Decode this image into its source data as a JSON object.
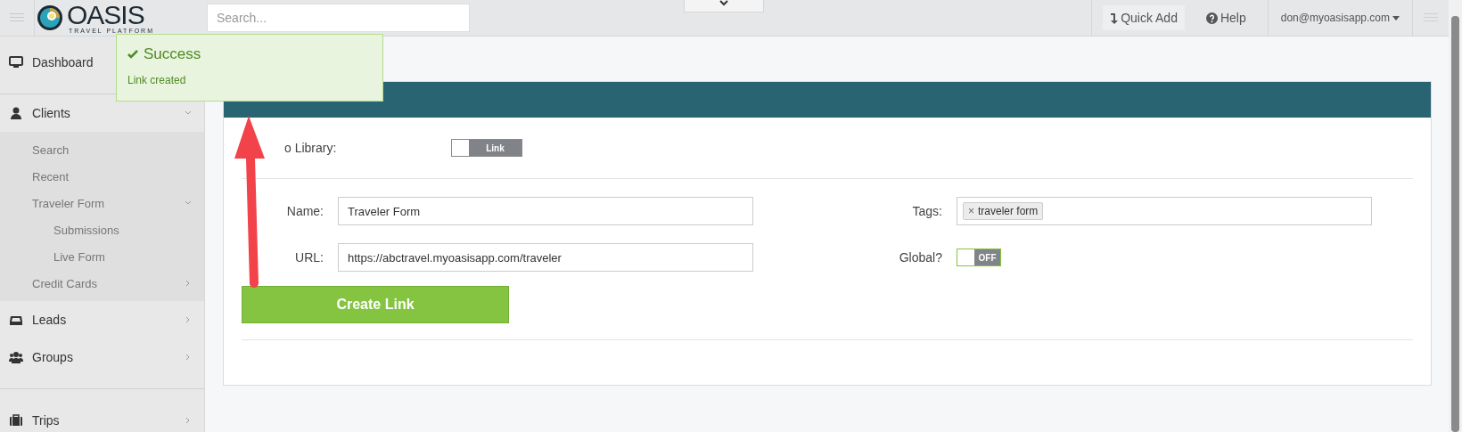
{
  "topbar": {
    "logo": {
      "name": "OASIS",
      "tagline": "TRAVEL PLATFORM"
    },
    "search": {
      "placeholder": "Search..."
    },
    "quick_add": "Quick Add",
    "help": "Help",
    "user": "don@myoasisapp.com"
  },
  "sidebar": {
    "items": [
      {
        "label": "Dashboard"
      },
      {
        "label": "Clients",
        "expanded": true,
        "children": [
          {
            "label": "Search"
          },
          {
            "label": "Recent"
          },
          {
            "label": "Traveler Form",
            "expanded": true,
            "children": [
              {
                "label": "Submissions"
              },
              {
                "label": "Live Form"
              }
            ]
          },
          {
            "label": "Credit Cards",
            "expanded": false
          }
        ]
      },
      {
        "label": "Leads",
        "expanded": false
      },
      {
        "label": "Groups",
        "expanded": false
      },
      {
        "label": "Trips",
        "expanded": false
      }
    ]
  },
  "toast": {
    "title": "Success",
    "message": "Link created"
  },
  "card": {
    "library": {
      "label": "o Library:",
      "toggle": {
        "label": "Link",
        "on": false
      }
    },
    "name": {
      "label": "Name:",
      "value": "Traveler Form"
    },
    "url": {
      "label": "URL:",
      "value": "https://abctravel.myoasisapp.com/traveler"
    },
    "tags": {
      "label": "Tags:",
      "items": [
        {
          "remove": "×",
          "text": "traveler form"
        }
      ]
    },
    "global": {
      "label": "Global?",
      "toggle": {
        "label": "OFF",
        "on": false
      }
    },
    "submit": "Create Link"
  }
}
